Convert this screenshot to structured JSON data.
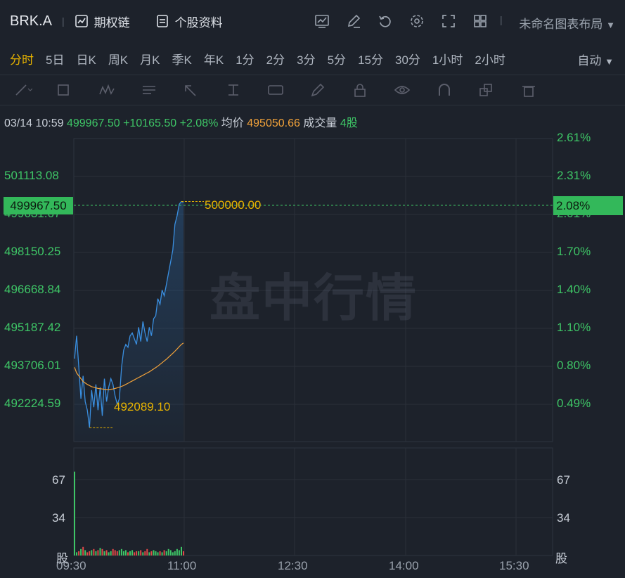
{
  "header": {
    "symbol": "BRK.A",
    "options_chain": "期权链",
    "stock_profile": "个股资料",
    "layout_name": "未命名图表布局",
    "layout_arrow": "▼",
    "tool_icons": [
      "indicator-chart-icon",
      "edit-icon",
      "reset-icon",
      "settings-icon",
      "fullscreen-icon",
      "grid-layout-icon"
    ]
  },
  "periods": [
    "分时",
    "5日",
    "日K",
    "周K",
    "月K",
    "季K",
    "年K",
    "1分",
    "2分",
    "3分",
    "5分",
    "15分",
    "30分",
    "1小时",
    "2小时"
  ],
  "active_period": "分时",
  "auto_label": "自动",
  "auto_arrow": "▼",
  "draw_tools": [
    "line-tool-icon",
    "rectangle-tool-icon",
    "wave-tool-icon",
    "text-tool-icon",
    "arrow-tool-icon",
    "measure-tool-icon",
    "label-tool-icon",
    "brush-icon",
    "lock-icon",
    "eye-icon",
    "magnet-icon",
    "layers-icon",
    "trash-icon"
  ],
  "info": {
    "datetime": "03/14 10:59",
    "price": "499967.50",
    "change": "+10165.50",
    "change_pct": "+2.08%",
    "avg_label": "均价",
    "avg_price": "495050.66",
    "volume_label": "成交量",
    "volume": "4股"
  },
  "price_axis": [
    "501113.08",
    "499631.67",
    "498150.25",
    "496668.84",
    "495187.42",
    "493706.01",
    "492224.59"
  ],
  "pct_axis": [
    "2.61%",
    "2.31%",
    "2.01%",
    "1.70%",
    "1.40%",
    "1.10%",
    "0.80%",
    "0.49%"
  ],
  "current_price_tag": "499967.50",
  "current_pct_tag": "2.08%",
  "high_annotation": "500000.00",
  "low_annotation": "492089.10",
  "watermark": "盘中行情",
  "volume_axis": [
    "67",
    "34"
  ],
  "volume_unit": "股",
  "time_axis": [
    "09:30",
    "11:00",
    "12:30",
    "14:00",
    "15:30"
  ],
  "colors": {
    "up": "#3ec566",
    "accent": "#e7b300",
    "price_line": "#3a8fe0",
    "avg_line": "#f2a23a",
    "down": "#e04848"
  },
  "chart_data": {
    "type": "line",
    "x_labels": [
      "09:30",
      "11:00",
      "12:30",
      "14:00",
      "15:30"
    ],
    "price_series_name": "",
    "price": [
      494500,
      495300,
      494200,
      493100,
      493900,
      493000,
      492700,
      492089.1,
      493400,
      492800,
      493600,
      492700,
      493500,
      492500,
      493800,
      493000,
      493500,
      493800,
      493600,
      493200,
      492900,
      493100,
      494200,
      494800,
      495000,
      494900,
      495300,
      495400,
      495200,
      495000,
      495600,
      495100,
      495800,
      495400,
      495100,
      495600,
      495300,
      495900,
      496000,
      496600,
      496400,
      496900,
      496700,
      497100,
      497500,
      497900,
      498300,
      499200,
      499500,
      499900,
      500000,
      499967.5
    ],
    "avg": [
      494200,
      494000,
      493900,
      493800,
      493700,
      493650,
      493600,
      493560,
      493520,
      493500,
      493480,
      493460,
      493450,
      493440,
      493430,
      493420,
      493420,
      493430,
      493440,
      493460,
      493480,
      493500,
      493530,
      493560,
      493600,
      493640,
      493680,
      493720,
      493760,
      493800,
      493840,
      493880,
      493920,
      493960,
      494000,
      494040,
      494090,
      494140,
      494190,
      494240,
      494300,
      494360,
      494420,
      494480,
      494550,
      494620,
      494690,
      494760,
      494840,
      494920,
      495000,
      495050.66
    ],
    "volume": [
      78,
      3,
      4,
      6,
      8,
      5,
      3,
      4,
      5,
      6,
      4,
      5,
      7,
      6,
      4,
      5,
      3,
      4,
      6,
      5,
      4,
      5,
      6,
      4,
      5,
      3,
      4,
      5,
      3,
      4,
      4,
      5,
      3,
      4,
      6,
      3,
      4,
      5,
      4,
      3,
      4,
      3,
      5,
      4,
      6,
      5,
      3,
      4,
      6,
      5,
      8,
      4
    ],
    "volume_up": [
      true,
      true,
      false,
      true,
      false,
      true,
      false,
      false,
      true,
      false,
      true,
      false,
      true,
      false,
      true,
      false,
      true,
      true,
      false,
      false,
      false,
      true,
      true,
      true,
      true,
      false,
      true,
      true,
      false,
      false,
      true,
      false,
      true,
      false,
      false,
      true,
      false,
      true,
      true,
      true,
      false,
      true,
      false,
      true,
      true,
      true,
      true,
      true,
      true,
      true,
      true,
      false
    ],
    "price_ylim": [
      491600,
      502200
    ],
    "volume_ylim": [
      0,
      100
    ],
    "grid": true
  }
}
